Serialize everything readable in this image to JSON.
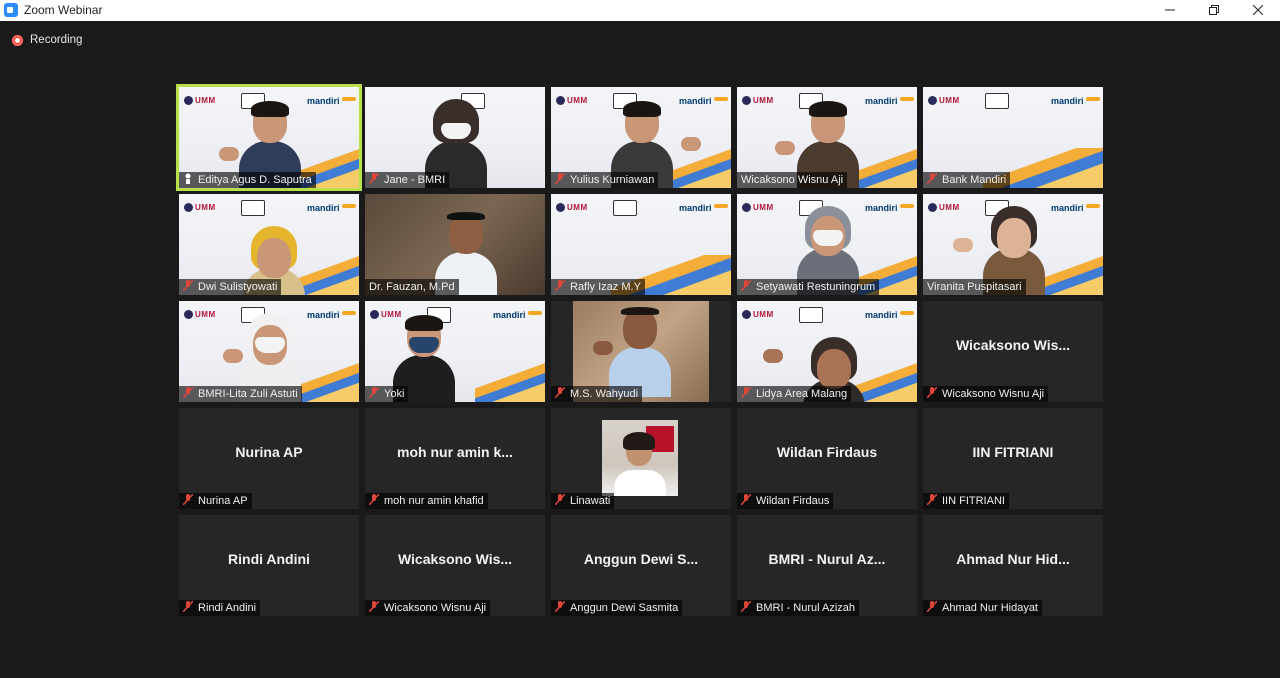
{
  "window": {
    "title": "Zoom Webinar"
  },
  "recording": {
    "label": "Recording"
  },
  "banner": {
    "umm": "UMM",
    "mandiri": "mandiri"
  },
  "participants": [
    {
      "name": "Editya Agus D. Saputra",
      "video": true,
      "active": true
    },
    {
      "name": "Jane - BMRI",
      "video": true
    },
    {
      "name": "Yulius Kurniawan",
      "video": true
    },
    {
      "name": "Wicaksono Wisnu Aji",
      "video": true
    },
    {
      "name": "Bank Mandiri",
      "video": true
    },
    {
      "name": "Dwi Sulistyowati",
      "video": true
    },
    {
      "name": "Dr. Fauzan, M.Pd",
      "video": true
    },
    {
      "name": "Rafly Izaz M.Y",
      "video": true
    },
    {
      "name": "Setyawati Restuningrum",
      "video": true
    },
    {
      "name": "Viranita Puspitasari",
      "video": true
    },
    {
      "name": "BMRI-Lita Zuli Astuti",
      "video": true
    },
    {
      "name": "Yoki",
      "video": true
    },
    {
      "name": "M.S. Wahyudi",
      "video": true
    },
    {
      "name": "Lidya Area Malang",
      "video": true
    },
    {
      "name": "Wicaksono Wisnu Aji",
      "display": "Wicaksono  Wis...",
      "video": false
    },
    {
      "name": "Nurina AP",
      "display": "Nurina AP",
      "video": false
    },
    {
      "name": "moh nur amin khafid",
      "display": "moh  nur  amin  k...",
      "video": false
    },
    {
      "name": "Linawati",
      "video": true
    },
    {
      "name": "Wildan Firdaus",
      "display": "Wildan Firdaus",
      "video": false
    },
    {
      "name": "IIN FITRIANI",
      "display": "IIN FITRIANI",
      "video": false
    },
    {
      "name": "Rindi Andini",
      "display": "Rindi Andini",
      "video": false
    },
    {
      "name": "Wicaksono Wisnu Aji",
      "display": "Wicaksono  Wis...",
      "video": false
    },
    {
      "name": "Anggun Dewi Sasmita",
      "display": "Anggun  Dewi  S...",
      "video": false
    },
    {
      "name": "BMRI - Nurul Azizah",
      "display": "BMRI  -  Nurul Az...",
      "video": false
    },
    {
      "name": "Ahmad Nur Hidayat",
      "display": "Ahmad  Nur  Hid...",
      "video": false
    }
  ],
  "colors": {
    "active_border": "#b8e04a",
    "muted_icon": "#e0463a",
    "background": "#1a1a1a"
  }
}
